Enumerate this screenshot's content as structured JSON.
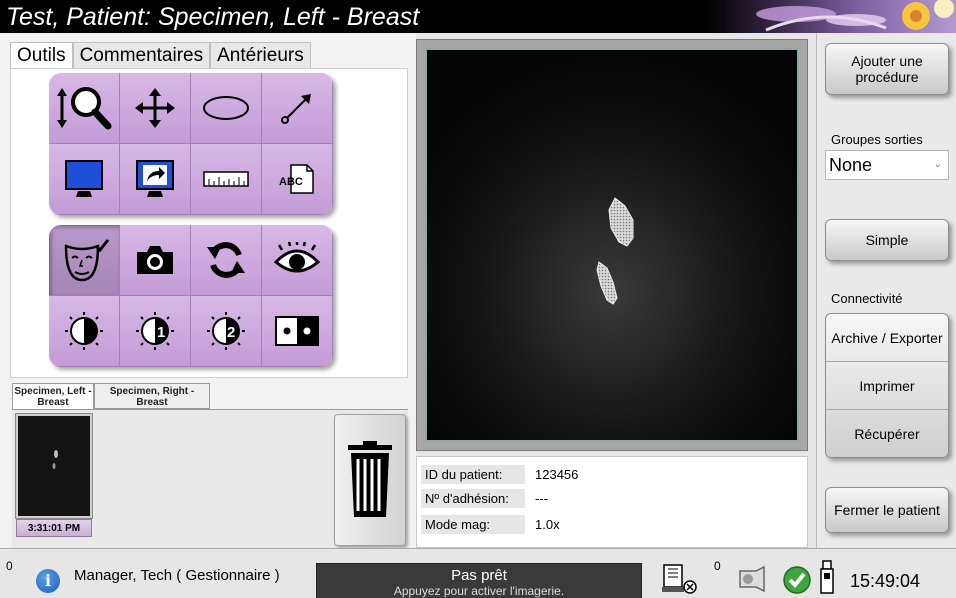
{
  "window": {
    "title": "Test, Patient:  Specimen, Left - Breast"
  },
  "left": {
    "tabs": [
      "Outils",
      "Commentaires",
      "Antérieurs"
    ],
    "thumb_tabs": [
      "Specimen, Left - Breast",
      "Specimen, Right - Breast"
    ],
    "thumbnail": {
      "time": "3:31:01 PM"
    }
  },
  "patient": {
    "id_label": "ID du patient:",
    "id_value": "123456",
    "accession_label": "Nº d'adhésion:",
    "accession_value": "---",
    "mag_label": "Mode mag:",
    "mag_value": "1.0x"
  },
  "right": {
    "add_procedure": "Ajouter une procédure",
    "output_groups_label": "Groupes sorties",
    "output_group_value": "None",
    "simple": "Simple",
    "connectivity_label": "Connectivité",
    "archive_export": "Archive / Exporter",
    "print": "Imprimer",
    "retrieve": "Récupérer",
    "close_patient": "Fermer le patient"
  },
  "status": {
    "count_left": "0",
    "user": "Manager, Tech ( Gestionnaire )",
    "state": "Pas prêt",
    "state_hint": "Appuyez pour activer l'imagerie.",
    "count_right": "0",
    "time": "15:49:04"
  },
  "colors": {
    "tool_button": "#c8a2d8",
    "titlebar": "#000000",
    "status_box": "#3a3a3a"
  }
}
